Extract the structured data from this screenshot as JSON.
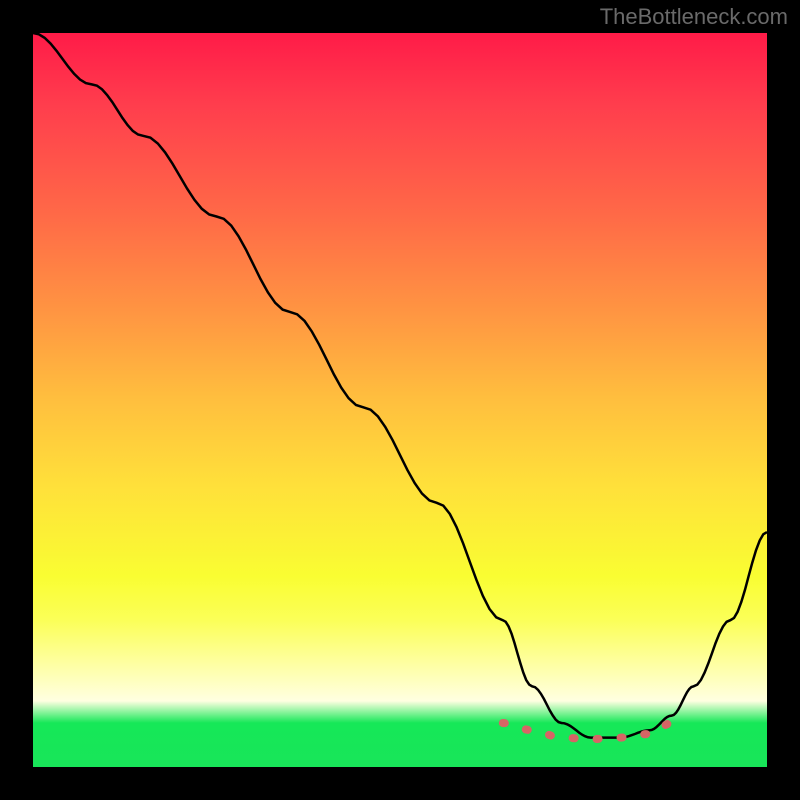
{
  "watermark": "TheBottleneck.com",
  "chart_data": {
    "type": "line",
    "title": "",
    "xlabel": "",
    "ylabel": "",
    "xlim": [
      0,
      100
    ],
    "ylim": [
      0,
      100
    ],
    "series": [
      {
        "name": "bottleneck-curve",
        "x": [
          0,
          8,
          15,
          25,
          35,
          45,
          55,
          64,
          68,
          72,
          76,
          80,
          84,
          87,
          90,
          95,
          100
        ],
        "values": [
          100,
          93,
          86,
          75,
          62,
          49,
          36,
          20,
          11,
          6,
          4,
          4,
          5,
          7,
          11,
          20,
          32
        ]
      },
      {
        "name": "optimal-zone-marker",
        "x": [
          64,
          68,
          72,
          76,
          80,
          84,
          87
        ],
        "values": [
          6,
          5,
          4,
          3.8,
          4,
          4.5,
          6
        ]
      }
    ],
    "colors": {
      "curve": "#000000",
      "marker": "#d66565",
      "gradient_top": "#ff1b48",
      "gradient_bottom": "#18e559"
    }
  }
}
